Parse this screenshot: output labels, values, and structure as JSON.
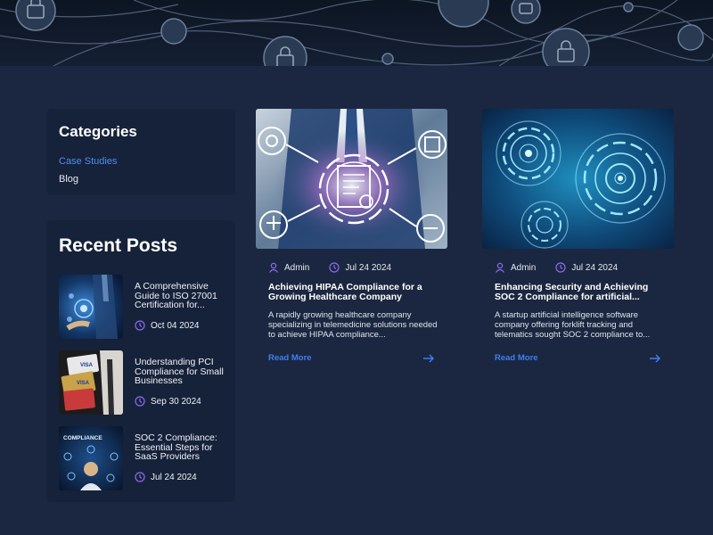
{
  "categories": {
    "heading": "Categories",
    "items": [
      {
        "label": "Case Studies",
        "active": true
      },
      {
        "label": "Blog",
        "active": false
      }
    ]
  },
  "recent_posts": {
    "heading": "Recent Posts",
    "items": [
      {
        "title": "A Comprehensive Guide to ISO 27001 Certification for...",
        "date": "Oct 04 2024"
      },
      {
        "title": "Understanding PCI Compliance for Small Businesses",
        "date": "Sep 30 2024"
      },
      {
        "title": "SOC 2 Compliance: Essential Steps for SaaS Providers",
        "date": "Jul 24 2024"
      }
    ]
  },
  "articles": [
    {
      "author": "Admin",
      "date": "Jul 24 2024",
      "title": "Achieving HIPAA Compliance for a Growing Healthcare Company",
      "excerpt": "A rapidly growing healthcare company specializing in telemedicine solutions needed to achieve HIPAA compliance...",
      "read_more": "Read More"
    },
    {
      "author": "Admin",
      "date": "Jul 24 2024",
      "title": "Enhancing Security and Achieving SOC 2 Compliance for artificial...",
      "excerpt": "A startup artificial intelligence software company offering forklift tracking and telematics sought SOC 2 compliance to...",
      "read_more": "Read More"
    }
  ],
  "thumb_labels": {
    "visa": "VISA",
    "compliance": "COMPLIANCE"
  },
  "colors": {
    "page_bg": "#1b2740",
    "card_bg": "#16223a",
    "accent_link": "#4f8df0",
    "icon_purple": "#8a6cf0"
  },
  "icons": {
    "author": "user-icon",
    "date": "clock-icon",
    "article_date": "calendar-icon",
    "read_more": "arrow-right-icon"
  }
}
